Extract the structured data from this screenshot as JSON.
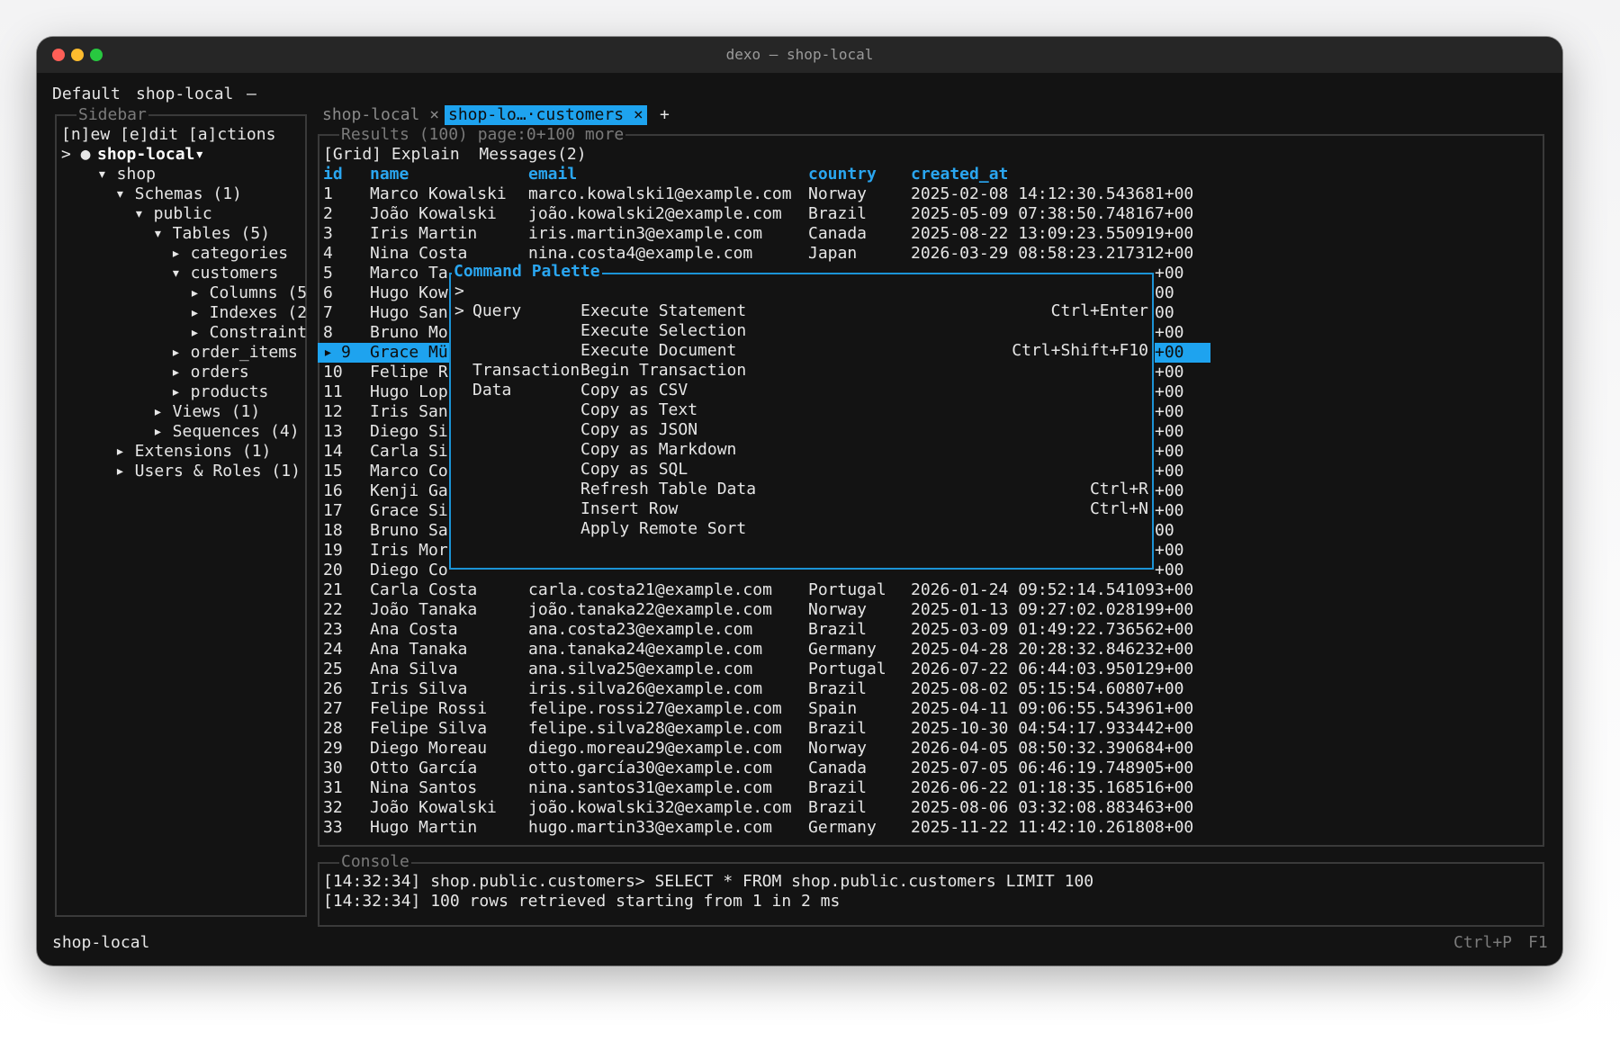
{
  "window": {
    "title": "dexo — shop-local"
  },
  "topbar": {
    "profile": "Default",
    "connection": "shop-local",
    "dash": "—"
  },
  "sidebar": {
    "label": "Sidebar",
    "actions": "[n]ew [e]dit [a]ctions",
    "tree": [
      {
        "text": "> ●",
        "indent": 0
      },
      {
        "text": "shop-local▾",
        "indent": 0
      },
      {
        "text": "▾ shop",
        "indent": 0
      },
      {
        "text": "▾ Schemas (1)",
        "indent": 0
      },
      {
        "text": "▾ public",
        "indent": 0
      },
      {
        "text": "▾ Tables (5)",
        "indent": 0
      },
      {
        "text": "▸ categories",
        "indent": 0
      },
      {
        "text": "▾ customers",
        "indent": 0
      },
      {
        "text": "▸ Columns (5",
        "indent": 0
      },
      {
        "text": "▸ Indexes (2",
        "indent": 0
      },
      {
        "text": "▸ Constraint",
        "indent": 0
      },
      {
        "text": "▸ order_items",
        "indent": 0
      },
      {
        "text": "▸ orders",
        "indent": 0
      },
      {
        "text": "▸ products",
        "indent": 0
      },
      {
        "text": "▸ Views (1)",
        "indent": 0
      },
      {
        "text": "▸ Sequences (4)",
        "indent": 0
      },
      {
        "text": "▸ Extensions (1)",
        "indent": 0
      },
      {
        "text": "▸ Users & Roles (1)",
        "indent": 0
      }
    ]
  },
  "tabs": {
    "items": [
      {
        "label": "shop-local",
        "close": "×"
      },
      {
        "label": "shop-lo…·customers",
        "close": "×"
      }
    ],
    "add": "+"
  },
  "results": {
    "label": "Results (100) page:0+100 more",
    "subtabs": "[Grid] Explain  Messages(2)",
    "columns": [
      "id",
      "name",
      "email",
      "country",
      "created_at"
    ],
    "rows": [
      [
        "1",
        "Marco Kowalski",
        "marco.kowalski1@example.com",
        "Norway",
        "2025-02-08 14:12:30.543681+00"
      ],
      [
        "2",
        "João Kowalski",
        "joão.kowalski2@example.com",
        "Brazil",
        "2025-05-09 07:38:50.748167+00"
      ],
      [
        "3",
        "Iris Martin",
        "iris.martin3@example.com",
        "Canada",
        "2025-08-22 13:09:23.550919+00"
      ],
      [
        "4",
        "Nina Costa",
        "nina.costa4@example.com",
        "Japan",
        "2026-03-29 08:58:23.217312+00"
      ],
      [
        "5",
        "Marco Ta",
        "",
        "",
        "+00"
      ],
      [
        "6",
        "Hugo Kow",
        "",
        "",
        "00"
      ],
      [
        "7",
        "Hugo San",
        "",
        "",
        "00"
      ],
      [
        "8",
        "Bruno Mo",
        "",
        "",
        "+00"
      ],
      [
        "9",
        "Grace Mü",
        "",
        "",
        "+00"
      ],
      [
        "10",
        "Felipe R",
        "",
        "",
        "+00"
      ],
      [
        "11",
        "Hugo Lop",
        "",
        "",
        "+00"
      ],
      [
        "12",
        "Iris San",
        "",
        "",
        "+00"
      ],
      [
        "13",
        "Diego Si",
        "",
        "",
        "+00"
      ],
      [
        "14",
        "Carla Si",
        "",
        "",
        "+00"
      ],
      [
        "15",
        "Marco Co",
        "",
        "",
        "+00"
      ],
      [
        "16",
        "Kenji Ga",
        "",
        "",
        "+00"
      ],
      [
        "17",
        "Grace Si",
        "",
        "",
        "+00"
      ],
      [
        "18",
        "Bruno Sa",
        "",
        "",
        "00"
      ],
      [
        "19",
        "Iris Mor",
        "",
        "",
        "+00"
      ],
      [
        "20",
        "Diego Co",
        "",
        "",
        "+00"
      ],
      [
        "21",
        "Carla Costa",
        "carla.costa21@example.com",
        "Portugal",
        "2026-01-24 09:52:14.541093+00"
      ],
      [
        "22",
        "João Tanaka",
        "joão.tanaka22@example.com",
        "Norway",
        "2025-01-13 09:27:02.028199+00"
      ],
      [
        "23",
        "Ana Costa",
        "ana.costa23@example.com",
        "Brazil",
        "2025-03-09 01:49:22.736562+00"
      ],
      [
        "24",
        "Ana Tanaka",
        "ana.tanaka24@example.com",
        "Germany",
        "2025-04-28 20:28:32.846232+00"
      ],
      [
        "25",
        "Ana Silva",
        "ana.silva25@example.com",
        "Portugal",
        "2026-07-22 06:44:03.950129+00"
      ],
      [
        "26",
        "Iris Silva",
        "iris.silva26@example.com",
        "Brazil",
        "2025-08-02 05:15:54.60807+00"
      ],
      [
        "27",
        "Felipe Rossi",
        "felipe.rossi27@example.com",
        "Spain",
        "2025-04-11 09:06:55.543961+00"
      ],
      [
        "28",
        "Felipe Silva",
        "felipe.silva28@example.com",
        "Brazil",
        "2025-10-30 04:54:17.933442+00"
      ],
      [
        "29",
        "Diego Moreau",
        "diego.moreau29@example.com",
        "Norway",
        "2026-04-05 08:50:32.390684+00"
      ],
      [
        "30",
        "Otto García",
        "otto.garcía30@example.com",
        "Canada",
        "2025-07-05 06:46:19.748905+00"
      ],
      [
        "31",
        "Nina Santos",
        "nina.santos31@example.com",
        "Brazil",
        "2026-06-22 01:18:35.168516+00"
      ],
      [
        "32",
        "João Kowalski",
        "joão.kowalski32@example.com",
        "Brazil",
        "2025-08-06 03:32:08.883463+00"
      ],
      [
        "33",
        "Hugo Martin",
        "hugo.martin33@example.com",
        "Germany",
        "2025-11-22 11:42:10.261808+00"
      ]
    ],
    "selected_row_marker": "▸"
  },
  "palette": {
    "title": "Command Palette",
    "prompt": ">",
    "items": [
      {
        "marker": ">",
        "group": "Query",
        "label": "Execute Statement",
        "shortcut": "Ctrl+Enter"
      },
      {
        "marker": "",
        "group": "",
        "label": "Execute Selection",
        "shortcut": ""
      },
      {
        "marker": "",
        "group": "",
        "label": "Execute Document",
        "shortcut": "Ctrl+Shift+F10"
      },
      {
        "marker": "",
        "group": "Transaction",
        "label": "Begin Transaction",
        "shortcut": ""
      },
      {
        "marker": "",
        "group": "Data",
        "label": "Copy as CSV",
        "shortcut": ""
      },
      {
        "marker": "",
        "group": "",
        "label": "Copy as Text",
        "shortcut": ""
      },
      {
        "marker": "",
        "group": "",
        "label": "Copy as JSON",
        "shortcut": ""
      },
      {
        "marker": "",
        "group": "",
        "label": "Copy as Markdown",
        "shortcut": ""
      },
      {
        "marker": "",
        "group": "",
        "label": "Copy as SQL",
        "shortcut": ""
      },
      {
        "marker": "",
        "group": "",
        "label": "Refresh Table Data",
        "shortcut": "Ctrl+R"
      },
      {
        "marker": "",
        "group": "",
        "label": "Insert Row",
        "shortcut": "Ctrl+N"
      },
      {
        "marker": "",
        "group": "",
        "label": "Apply Remote Sort",
        "shortcut": ""
      }
    ]
  },
  "console": {
    "label": "Console",
    "lines": [
      "[14:32:34] shop.public.customers> SELECT * FROM shop.public.customers LIMIT 100",
      "[14:32:34] 100 rows retrieved starting from 1 in 2 ms"
    ]
  },
  "statusbar": {
    "left": "shop-local",
    "shortcut": "Ctrl+P",
    "help": "F1"
  },
  "colors": {
    "accent": "#1ea3ef",
    "background": "#131313",
    "titlebar": "#262626",
    "close": "#fe5f57",
    "minimize": "#febc2e",
    "maximize": "#28c840"
  }
}
